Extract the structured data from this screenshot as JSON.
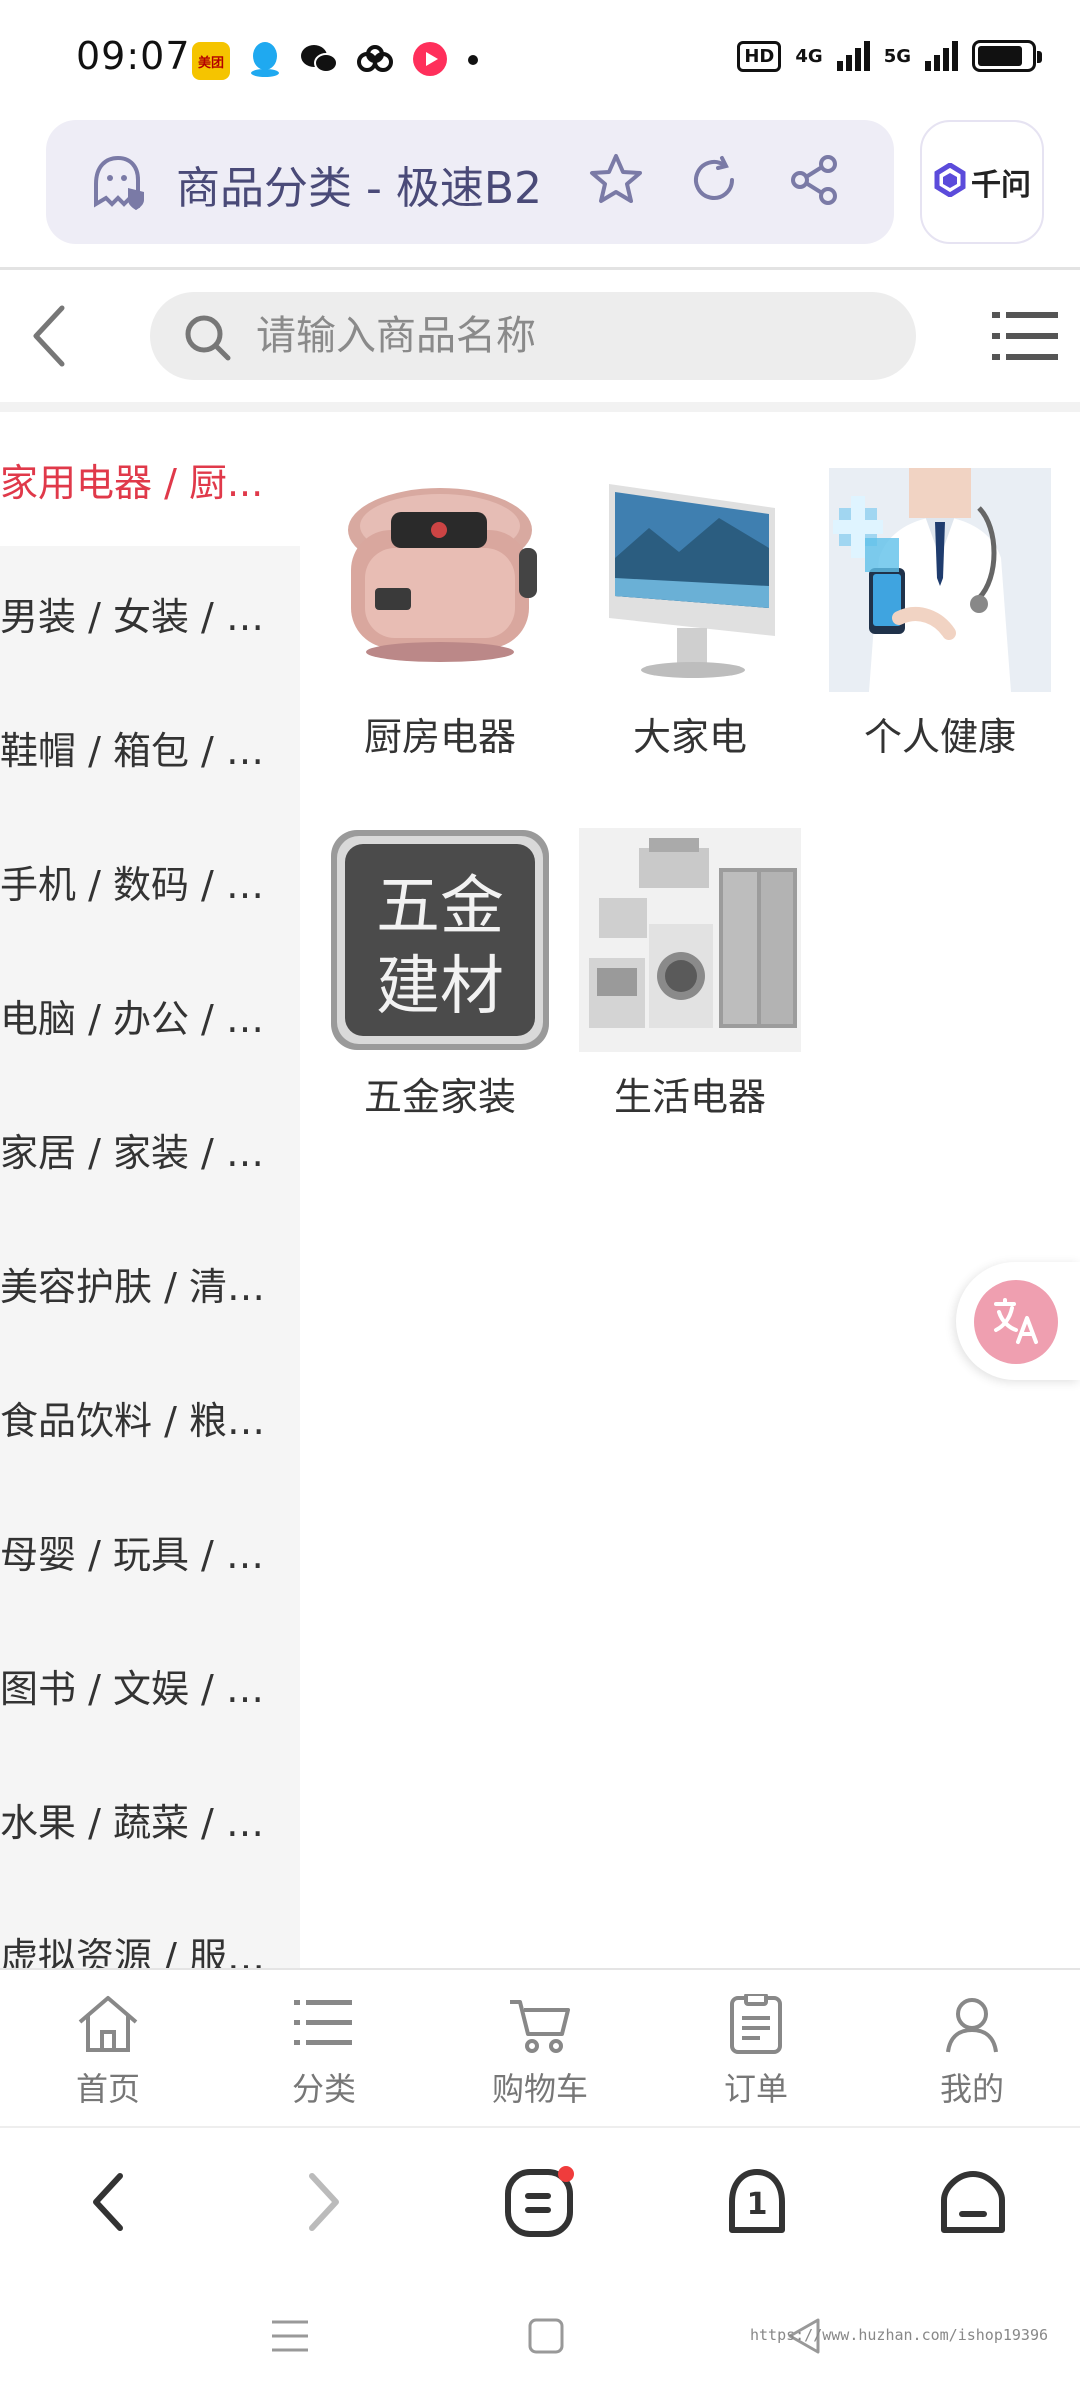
{
  "status_bar": {
    "time": "09:07",
    "hd_label": "HD",
    "net_1": "4G",
    "net_2": "5G",
    "battery_level": 0.85,
    "app_icons": [
      "meituan-icon",
      "qq-icon",
      "wechat-icon",
      "cloud-icon",
      "video-icon",
      "dot-icon"
    ]
  },
  "browser": {
    "title": "商品分类 - 极速B2",
    "assistant_label": "千问"
  },
  "search": {
    "placeholder": "请输入商品名称"
  },
  "categories": [
    {
      "label": "家用电器 / 厨...",
      "active": true
    },
    {
      "label": "男装 / 女装 / 内...",
      "active": false
    },
    {
      "label": "鞋帽 / 箱包 / 钟...",
      "active": false
    },
    {
      "label": "手机 / 数码 / 通...",
      "active": false
    },
    {
      "label": "电脑 / 办公 / 配...",
      "active": false
    },
    {
      "label": "家居 / 家装 / 厨...",
      "active": false
    },
    {
      "label": "美容护肤 / 清洁...",
      "active": false
    },
    {
      "label": "食品饮料 / 粮油...",
      "active": false
    },
    {
      "label": "母婴 / 玩具 / 乐...",
      "active": false
    },
    {
      "label": "图书 / 文娱 / 教...",
      "active": false
    },
    {
      "label": "水果 / 蔬菜 / 生...",
      "active": false
    },
    {
      "label": "虚拟资源 / 服务...",
      "active": false
    }
  ],
  "subcategories": [
    {
      "label": "厨房电器",
      "image": "rice-cooker"
    },
    {
      "label": "大家电",
      "image": "monitor"
    },
    {
      "label": "个人健康",
      "image": "doctor"
    },
    {
      "label": "五金家装",
      "image": "hardware-sign",
      "image_text_1": "五金",
      "image_text_2": "建材"
    },
    {
      "label": "生活电器",
      "image": "appliances"
    }
  ],
  "tabbar": [
    {
      "label": "首页",
      "icon": "home-icon"
    },
    {
      "label": "分类",
      "icon": "list-icon"
    },
    {
      "label": "购物车",
      "icon": "cart-icon"
    },
    {
      "label": "订单",
      "icon": "order-icon"
    },
    {
      "label": "我的",
      "icon": "user-icon"
    }
  ],
  "browser_nav": {
    "tab_count": "1"
  },
  "watermark": "https://www.huzhan.com/ishop19396",
  "colors": {
    "accent": "#e0394a",
    "url_pill": "#eeedf6",
    "title_text": "#4a4a78",
    "qianwen_brand": "#5b4bdb",
    "translate": "#ef9fb0"
  }
}
